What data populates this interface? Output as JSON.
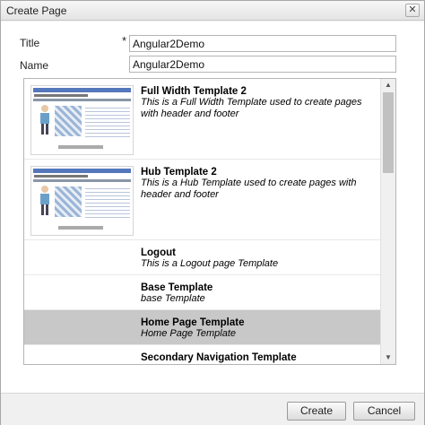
{
  "dialog": {
    "title": "Create Page"
  },
  "form": {
    "title_label": "Title",
    "required_mark": "*",
    "title_value": "Angular2Demo",
    "name_label": "Name",
    "name_value": "Angular2Demo"
  },
  "templates": [
    {
      "name": "Full Width Template 2",
      "description": "This is a Full Width Template used to create pages with header and footer",
      "has_thumbnail": true,
      "selected": false
    },
    {
      "name": "Hub Template 2",
      "description": "This is a Hub Template used to create pages with header and footer",
      "has_thumbnail": true,
      "selected": false
    },
    {
      "name": "Logout",
      "description": "This is a Logout page Template",
      "has_thumbnail": false,
      "selected": false
    },
    {
      "name": "Base Template",
      "description": "base Template",
      "has_thumbnail": false,
      "selected": false
    },
    {
      "name": "Home Page Template",
      "description": "Home Page Template",
      "has_thumbnail": false,
      "selected": true
    },
    {
      "name": "Secondary Navigation Template",
      "description": "",
      "has_thumbnail": false,
      "selected": false
    }
  ],
  "icons": {
    "close": "close-icon",
    "scroll_up": "scroll-up-arrow-icon",
    "scroll_down": "scroll-down-arrow-icon"
  },
  "buttons": {
    "create": "Create",
    "cancel": "Cancel"
  },
  "colors": {
    "selected_row": "#c8c8c8",
    "dialog_bg": "#f0f0f0"
  }
}
